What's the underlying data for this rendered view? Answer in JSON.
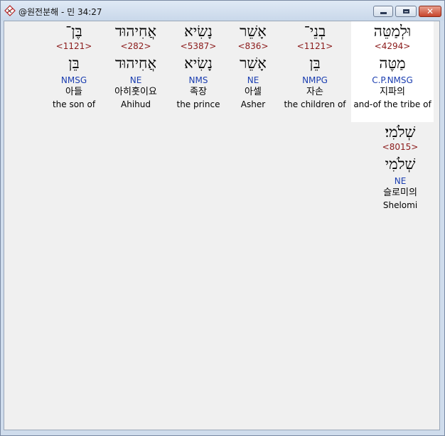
{
  "window": {
    "title": "@원전분해 - 민 34:27"
  },
  "words": [
    {
      "hebrew": "וּלְמַטֵּה",
      "strong": "<4294>",
      "lemma": "מַטֶּה",
      "morph": "C.P.NMSG",
      "korean": "지파의",
      "english": "and-of the tribe of",
      "selected": true
    },
    {
      "hebrew": "בְנֵי־",
      "strong": "<1121>",
      "lemma": "בֵּן",
      "morph": "NMPG",
      "korean": "자손",
      "english": "the children of",
      "selected": false
    },
    {
      "hebrew": "אָשֵׁר",
      "strong": "<836>",
      "lemma": "אָשֵׁר",
      "morph": "NE",
      "korean": "아셀",
      "english": "Asher",
      "selected": false
    },
    {
      "hebrew": "נָשִׂיא",
      "strong": "<5387>",
      "lemma": "נָשִׂיא",
      "morph": "NMS",
      "korean": "족장",
      "english": "the prince",
      "selected": false
    },
    {
      "hebrew": "אֲחִיהוּד",
      "strong": "<282>",
      "lemma": "אֲחִיהוּד",
      "morph": "NE",
      "korean": "아히훗이요",
      "english": "Ahihud",
      "selected": false
    },
    {
      "hebrew": "בֶּן־",
      "strong": "<1121>",
      "lemma": "בֵּן",
      "morph": "NMSG",
      "korean": "아들",
      "english": "the son of",
      "selected": false
    },
    {
      "hebrew": "שְׁלֹמִי׃",
      "strong": "<8015>",
      "lemma": "שְׁלֹמִי",
      "morph": "NE",
      "korean": "슬로미의",
      "english": "Shelomi",
      "selected": false
    }
  ]
}
